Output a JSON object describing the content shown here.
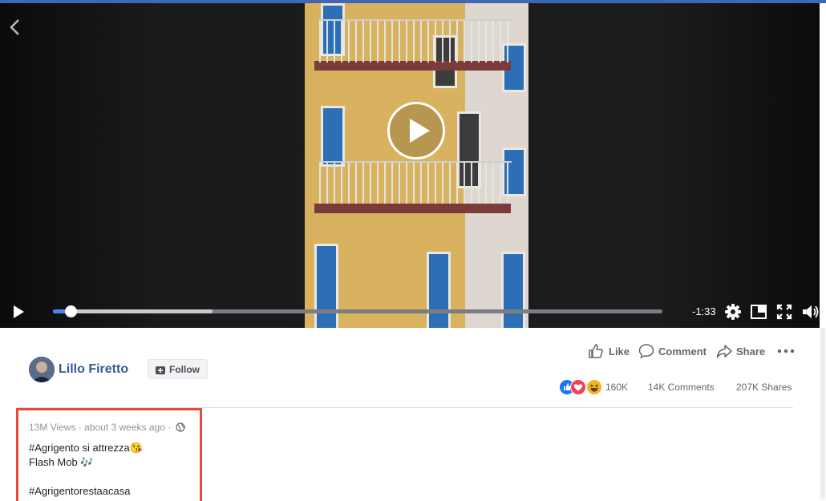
{
  "video": {
    "time_remaining": "-1:33",
    "progress_fraction": 0.029,
    "buffered_fraction": 0.262
  },
  "icons": {
    "back": "chevron-left-icon",
    "center_play": "play-icon",
    "play": "play-icon",
    "settings": "gear-icon",
    "pip": "picture-in-picture-icon",
    "fullscreen": "fullscreen-icon",
    "volume": "volume-icon",
    "like": "thumbs-up-icon",
    "comment": "comment-bubble-icon",
    "share": "share-arrow-icon",
    "more": "more-dots-icon",
    "globe": "globe-icon",
    "follow": "follow-plus-icon"
  },
  "post": {
    "author": "Lillo Firetto",
    "follow_label": "Follow",
    "actions": {
      "like": "Like",
      "comment": "Comment",
      "share": "Share"
    },
    "stats": {
      "reactions": "160K",
      "comments": "14K Comments",
      "shares": "207K Shares"
    },
    "meta": "13M Views · about 3 weeks ago ·",
    "description": [
      "#Agrigento si attrezza😘",
      "Flash Mob 🎶",
      "",
      "#Agrigentorestaacasa"
    ]
  },
  "colors": {
    "brand_bar": "#4267b2",
    "link_blue": "#385898",
    "progress_played": "#4c86e8",
    "highlight_border": "#e84a3a"
  }
}
